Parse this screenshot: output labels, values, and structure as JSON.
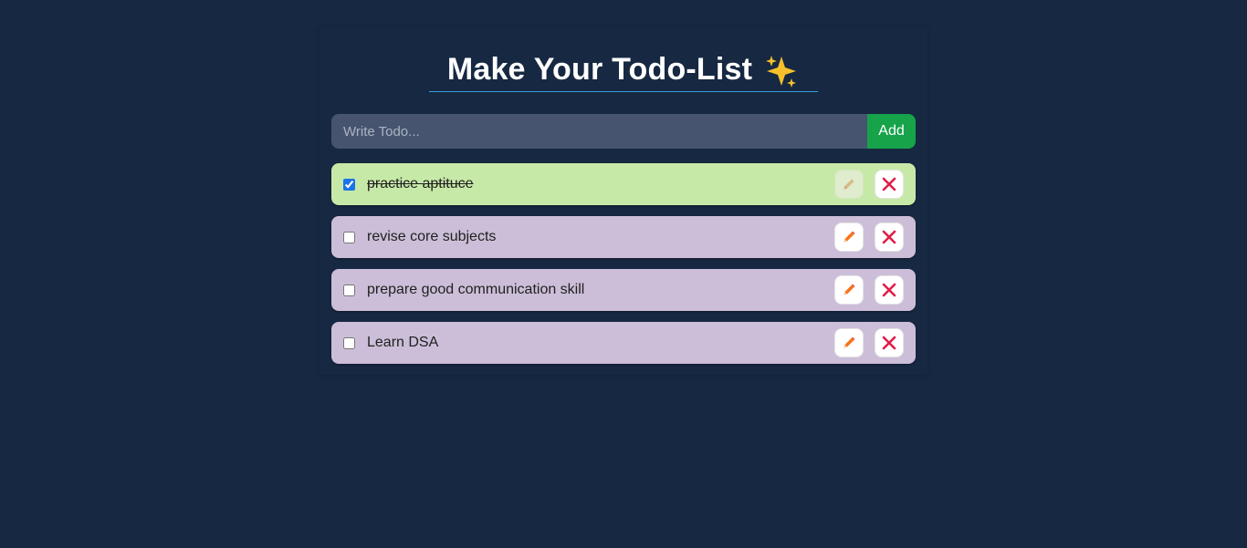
{
  "app": {
    "title": "Make Your Todo-List",
    "title_icon": "sparkles-icon"
  },
  "input": {
    "placeholder": "Write Todo...",
    "value": "",
    "add_label": "Add"
  },
  "colors": {
    "background": "#172842",
    "add_button": "#16a34a",
    "done_row": "#c7e9a8",
    "pending_row": "#ccbed8",
    "delete_icon": "#e11d48",
    "edit_icon": "#f97316"
  },
  "todos": [
    {
      "text": "practice aptituce",
      "completed": true,
      "edit_icon": "pencil-icon",
      "delete_icon": "close-icon"
    },
    {
      "text": "revise core subjects",
      "completed": false,
      "edit_icon": "pencil-icon",
      "delete_icon": "close-icon"
    },
    {
      "text": "prepare good communication skill",
      "completed": false,
      "edit_icon": "pencil-icon",
      "delete_icon": "close-icon"
    },
    {
      "text": "Learn DSA",
      "completed": false,
      "edit_icon": "pencil-icon",
      "delete_icon": "close-icon"
    }
  ]
}
